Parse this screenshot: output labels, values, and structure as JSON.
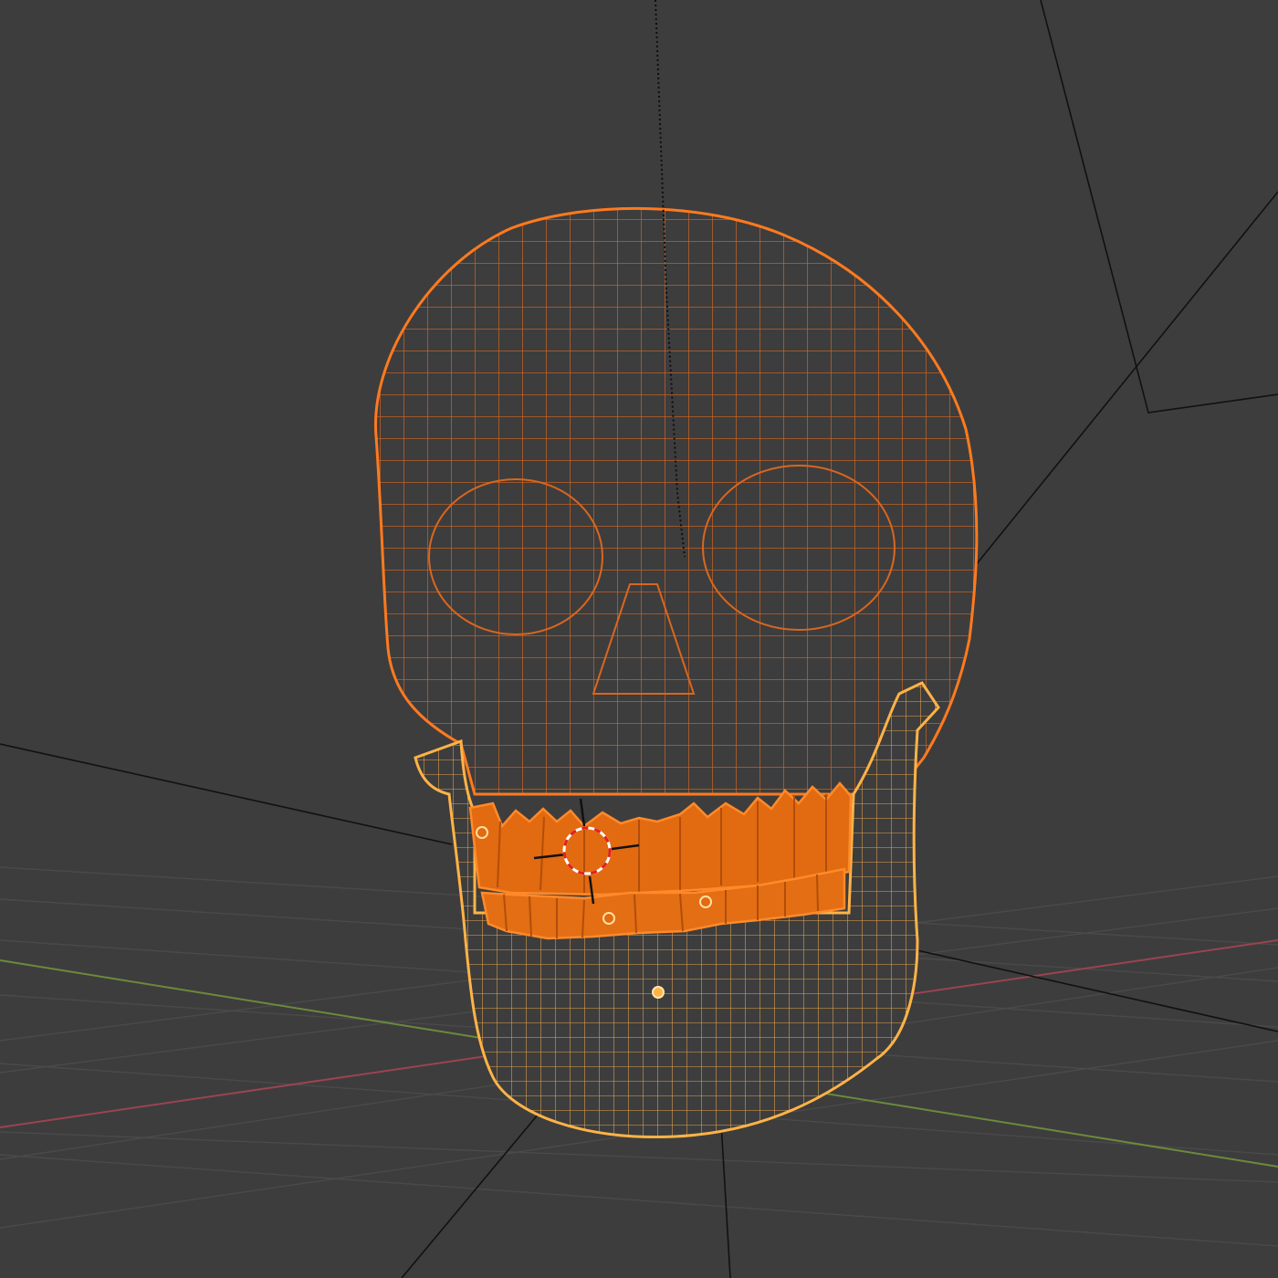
{
  "viewport": {
    "background": "#3d3d3d",
    "grid_color": "#4a4a4a",
    "x_axis_color": "#9a4450",
    "y_axis_color": "#6b8a3c"
  },
  "objects": {
    "cranium": {
      "state": "selected",
      "outline_color": "#ff7a1f",
      "wire_color": "#d9661f"
    },
    "upper_teeth": {
      "state": "selected",
      "fill_color": "#e26a10",
      "edge_color": "#ff8a2a"
    },
    "lower_teeth": {
      "state": "selected",
      "fill_color": "#e36e14",
      "edge_color": "#ff8a2a"
    },
    "mandible": {
      "state": "active",
      "outline_color": "#ffb347",
      "wire_color": "#e8a34a"
    }
  },
  "icons": {
    "cursor": "3d-cursor-icon",
    "origin": "object-origin-icon"
  }
}
